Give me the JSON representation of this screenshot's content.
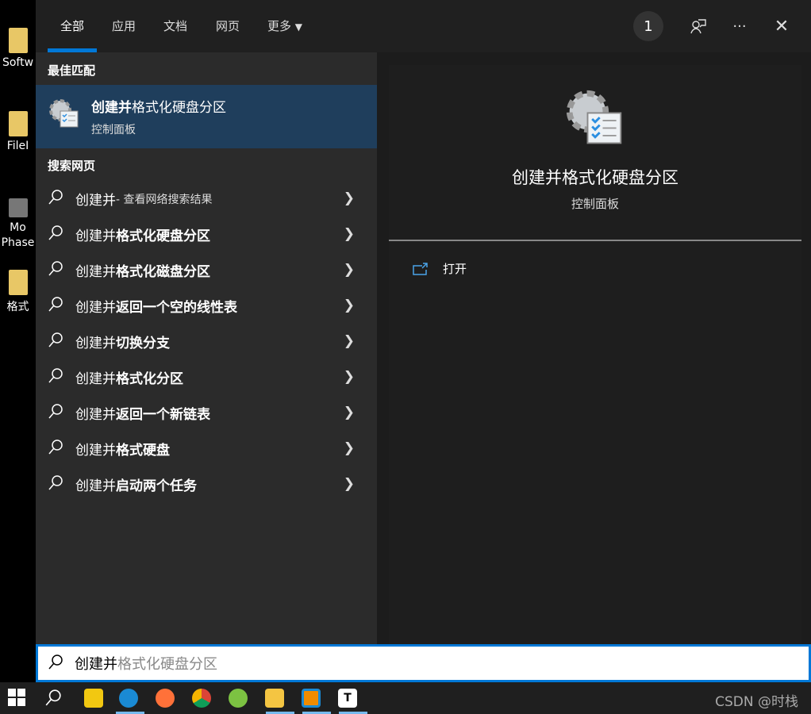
{
  "desktop": [
    "Softw",
    "FileI",
    "Mo Phase",
    "格式"
  ],
  "tabs": [
    "全部",
    "应用",
    "文档",
    "网页",
    "更多"
  ],
  "header": {
    "badge": "1"
  },
  "best_match": {
    "heading": "最佳匹配",
    "title_bold": "创建并",
    "title_rest": "格式化硬盘分区",
    "subtitle": "控制面板"
  },
  "web": {
    "heading": "搜索网页",
    "items": [
      {
        "prefix": "创建并",
        "suffix": " - 查看网络搜索结果",
        "plain": true
      },
      {
        "prefix": "创建并",
        "suffix": "格式化硬盘分区"
      },
      {
        "prefix": "创建并",
        "suffix": "格式化磁盘分区"
      },
      {
        "prefix": "创建并",
        "suffix": "返回一个空的线性表"
      },
      {
        "prefix": "创建并",
        "suffix": "切换分支"
      },
      {
        "prefix": "创建并",
        "suffix": "格式化分区"
      },
      {
        "prefix": "创建并",
        "suffix": "返回一个新链表"
      },
      {
        "prefix": "创建并",
        "suffix": "格式硬盘"
      },
      {
        "prefix": "创建并",
        "suffix": "启动两个任务"
      }
    ]
  },
  "preview": {
    "title": "创建并格式化硬盘分区",
    "subtitle": "控制面板",
    "open_label": "打开"
  },
  "search": {
    "typed": "创建并",
    "suggestion": "格式化硬盘分区"
  },
  "taskbar": {
    "watermark": "CSDN @时栈"
  },
  "colors": {
    "accent": "#0078d7",
    "selected": "#1f3e5c"
  }
}
